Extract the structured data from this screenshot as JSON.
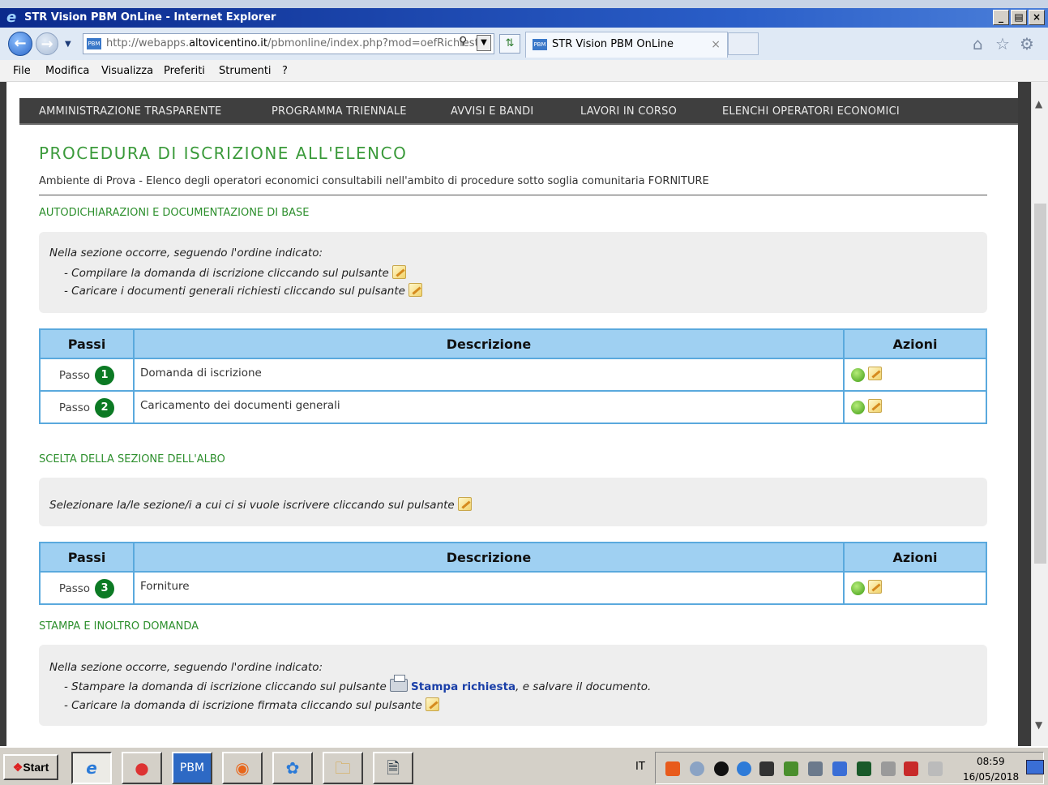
{
  "window": {
    "title": "STR Vision PBM OnLine - Internet Explorer",
    "buttons": [
      "_",
      "×"
    ]
  },
  "address_bar": {
    "prefix": "http://webapps.",
    "domain": "altovicentino.it",
    "path": "/pbmonline/index.php?mod=oefRichieste",
    "favicon_text": "PBM"
  },
  "tab": {
    "label": "STR Vision PBM OnLine",
    "favicon_text": "PBM",
    "close": "×"
  },
  "menu": [
    "File",
    "Modifica",
    "Visualizza",
    "Preferiti",
    "Strumenti",
    "?"
  ],
  "topnav": [
    "AMMINISTRAZIONE TRASPARENTE",
    "PROGRAMMA TRIENNALE",
    "AVVISI E BANDI",
    "LAVORI IN CORSO",
    "ELENCHI OPERATORI ECONOMICI"
  ],
  "page": {
    "title": "PROCEDURA DI ISCRIZIONE ALL'ELENCO",
    "subtitle": "Ambiente di Prova - Elenco degli operatori economici consultabili nell'ambito di procedure sotto soglia comunitaria FORNITURE"
  },
  "section1": {
    "title": "AUTODICHIARAZIONI E DOCUMENTAZIONE DI BASE",
    "info": [
      "Nella sezione occorre, seguendo l'ordine indicato:",
      "- Compilare la domanda di iscrizione cliccando sul pulsante",
      "- Caricare i documenti generali richiesti cliccando sul pulsante"
    ],
    "headers": [
      "Passi",
      "Descrizione",
      "Azioni"
    ],
    "rows": [
      {
        "step_label": "Passo",
        "step": "1",
        "description": "Domanda di iscrizione"
      },
      {
        "step_label": "Passo",
        "step": "2",
        "description": "Caricamento dei documenti generali"
      }
    ]
  },
  "section2": {
    "title": "SCELTA DELLA SEZIONE DELL'ALBO",
    "info": [
      "Selezionare la/le sezione/i a cui ci si vuole iscrivere cliccando sul pulsante"
    ],
    "headers": [
      "Passi",
      "Descrizione",
      "Azioni"
    ],
    "rows": [
      {
        "step_label": "Passo",
        "step": "3",
        "description": "Forniture"
      }
    ]
  },
  "section3": {
    "title": "STAMPA E INOLTRO DOMANDA",
    "info": [
      "Nella sezione occorre, seguendo l'ordine indicato:",
      "- Stampare la domanda di iscrizione cliccando sul pulsante",
      "Stampa richiesta",
      ", e salvare il documento.",
      "- Caricare la domanda di iscrizione firmata cliccando sul pulsante"
    ]
  },
  "taskbar": {
    "start": "Start",
    "pbm_label": "PBM",
    "lang": "IT",
    "time": "08:59",
    "date": "16/05/2018"
  },
  "colors": {
    "accent_green": "#2d8f2d",
    "table_header": "#9fd0f2",
    "table_border": "#5aa9dd",
    "step_badge": "#0c7a24",
    "nav_bg": "#3f3f3f"
  }
}
